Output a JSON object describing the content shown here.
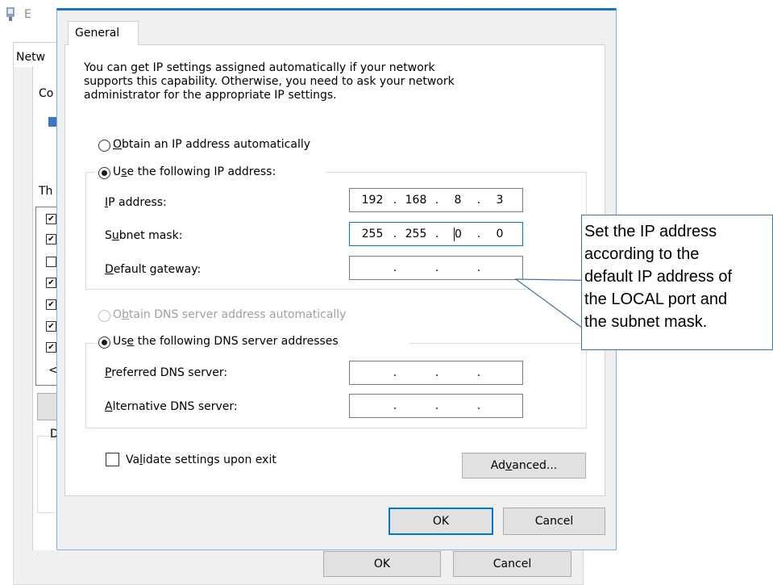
{
  "background_window": {
    "title_fragment": "E",
    "tab_fragment": "Netw",
    "connect_fragment": "Co",
    "this_fragment": "Th",
    "desc_fragment": "D",
    "scroll_left": "<",
    "checkbox_states": [
      true,
      true,
      false,
      true,
      true,
      true,
      true
    ],
    "ok_label": "OK",
    "cancel_label": "Cancel"
  },
  "dialog": {
    "tab_label": "General",
    "intro_text": "You can get IP settings assigned automatically if your network\nsupports this capability. Otherwise, you need to ask your network\nadministrator for the appropriate IP settings.",
    "ip_auto": {
      "u": "O",
      "rest": "btain an IP address automatically",
      "selected": false
    },
    "ip_manual": {
      "pre": "U",
      "u": "s",
      "rest": "e the following IP address:",
      "selected": true
    },
    "ip_address": {
      "u": "I",
      "rest": "P address:",
      "octets": [
        "192",
        "168",
        "8",
        "3"
      ]
    },
    "subnet_mask": {
      "pre": "S",
      "u": "u",
      "rest": "bnet mask:",
      "octets": [
        "255",
        "255",
        "0",
        "0"
      ]
    },
    "default_gateway": {
      "u": "D",
      "rest": "efault gateway:",
      "octets": [
        "",
        "",
        "",
        ""
      ]
    },
    "dns_auto": {
      "pre": "O",
      "u": "b",
      "rest": "tain DNS server address automatically",
      "selected": false,
      "disabled": true
    },
    "dns_manual": {
      "pre": "Us",
      "u": "e",
      "rest": " the following DNS server addresses",
      "selected": true
    },
    "preferred_dns": {
      "u": "P",
      "rest": "referred DNS server:",
      "octets": [
        "",
        "",
        "",
        ""
      ]
    },
    "alternate_dns": {
      "u": "A",
      "rest": "lternative DNS server:",
      "octets": [
        "",
        "",
        "",
        ""
      ]
    },
    "validate": {
      "pre": "Va",
      "u": "l",
      "rest": "idate settings upon exit",
      "checked": false
    },
    "advanced": {
      "pre": "Ad",
      "u": "v",
      "rest": "anced..."
    },
    "ok_label": "OK",
    "cancel_label": "Cancel"
  },
  "callout": {
    "text": "Set the IP address\naccording to the\ndefault IP address of\nthe LOCAL port and\nthe subnet mask."
  },
  "colors": {
    "accent": "#0078d7",
    "dialog_border": "#1e73be",
    "callout_border": "#41719c"
  }
}
